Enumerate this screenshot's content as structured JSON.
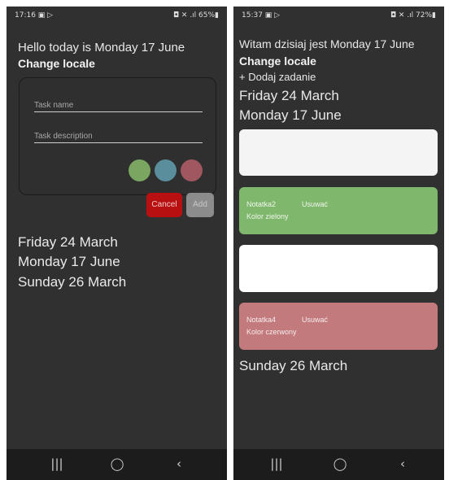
{
  "left": {
    "status": {
      "time": "17:16 ▣ ▷",
      "icons": "◘ ✕ .ıl 65%▮"
    },
    "greeting": "Hello today is Monday 17 June",
    "change_locale": "Change locale",
    "form": {
      "task_name_placeholder": "Task name",
      "task_description_placeholder": "Task description",
      "swatches": [
        {
          "name": "green",
          "color": "#7aa661"
        },
        {
          "name": "blue",
          "color": "#5a8e9c"
        },
        {
          "name": "red",
          "color": "#a1575f"
        }
      ],
      "cancel_label": "Cancel",
      "add_label": "Add"
    },
    "dates": [
      "Friday 24 March",
      "Monday 17 June",
      "Sunday 26 March"
    ],
    "nav": {
      "recents": "|||",
      "home": "◯",
      "back": "‹"
    }
  },
  "right": {
    "status": {
      "time": "15:37 ▣ ▷",
      "icons": "◘ ✕ .ıl 72%▮"
    },
    "greeting": "Witam dzisiaj jest Monday 17 June",
    "change_locale": "Change locale",
    "add_task": "+ Dodaj zadanie",
    "date1": "Friday 24 March",
    "date2": "Monday 17 June",
    "cards": [
      {
        "color": "#f4f4f4",
        "text_color": "#f4f4f4",
        "title": "",
        "delete": "",
        "subtitle": ""
      },
      {
        "color": "#7fb76d",
        "text_color": "#f0f6ec",
        "title": "Notatka2",
        "delete": "Usuwać",
        "subtitle": "Kolor zielony"
      },
      {
        "color": "#ffffff",
        "text_color": "#ffffff",
        "title": "",
        "delete": "",
        "subtitle": ""
      },
      {
        "color": "#c27a7d",
        "text_color": "#f8ecec",
        "title": "Notatka4",
        "delete": "Usuwać",
        "subtitle": "Kolor czerwony"
      }
    ],
    "date3": "Sunday 26 March",
    "nav": {
      "recents": "|||",
      "home": "◯",
      "back": "‹"
    }
  }
}
